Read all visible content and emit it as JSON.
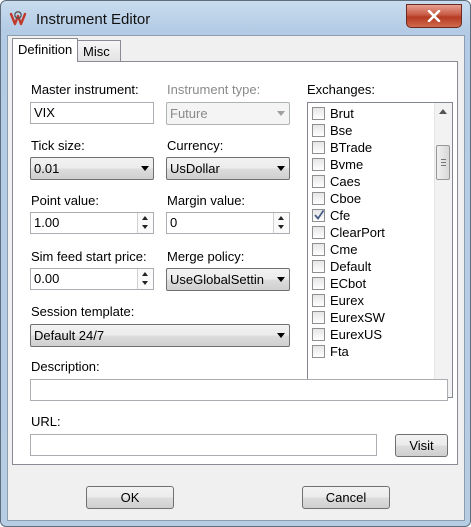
{
  "window": {
    "title": "Instrument Editor"
  },
  "tabs": [
    {
      "label": "Definition"
    },
    {
      "label": "Misc"
    }
  ],
  "definition": {
    "master_instrument": {
      "label": "Master instrument:",
      "value": "VIX"
    },
    "instrument_type": {
      "label": "Instrument type:",
      "value": "Future"
    },
    "tick_size": {
      "label": "Tick size:",
      "value": "0.01"
    },
    "currency": {
      "label": "Currency:",
      "value": "UsDollar"
    },
    "point_value": {
      "label": "Point value:",
      "value": "1.00"
    },
    "margin_value": {
      "label": "Margin value:",
      "value": "0"
    },
    "sim_feed_start_price": {
      "label": "Sim feed start price:",
      "value": "0.00"
    },
    "merge_policy": {
      "label": "Merge policy:",
      "value": "UseGlobalSettin"
    },
    "session_template": {
      "label": "Session template:",
      "value": "Default 24/7"
    },
    "description": {
      "label": "Description:",
      "value": ""
    },
    "url": {
      "label": "URL:",
      "value": ""
    },
    "visit_label": "Visit",
    "exchanges": {
      "label": "Exchanges:",
      "items": [
        {
          "name": "Brut",
          "checked": false
        },
        {
          "name": "Bse",
          "checked": false
        },
        {
          "name": "BTrade",
          "checked": false
        },
        {
          "name": "Bvme",
          "checked": false
        },
        {
          "name": "Caes",
          "checked": false
        },
        {
          "name": "Cboe",
          "checked": false
        },
        {
          "name": "Cfe",
          "checked": true
        },
        {
          "name": "ClearPort",
          "checked": false
        },
        {
          "name": "Cme",
          "checked": false
        },
        {
          "name": "Default",
          "checked": false
        },
        {
          "name": "ECbot",
          "checked": false
        },
        {
          "name": "Eurex",
          "checked": false
        },
        {
          "name": "EurexSW",
          "checked": false
        },
        {
          "name": "EurexUS",
          "checked": false
        },
        {
          "name": "Fta",
          "checked": false
        }
      ]
    }
  },
  "footer": {
    "ok_label": "OK",
    "cancel_label": "Cancel"
  },
  "colors": {
    "title_bar": "#b7cde4",
    "close_button": "#c75a44",
    "check_mark": "#4a5f87"
  }
}
